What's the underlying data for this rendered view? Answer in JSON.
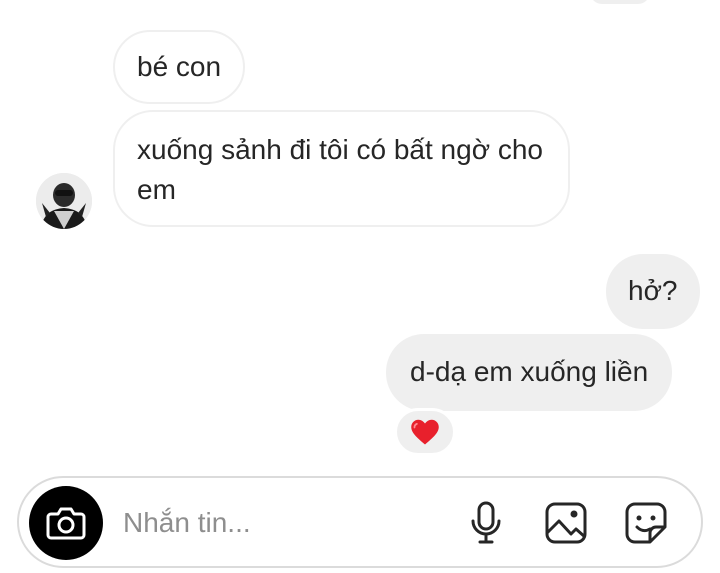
{
  "messages": [
    {
      "sender": "them",
      "text": "bé con"
    },
    {
      "sender": "them",
      "text": "xuống sảnh đi tôi có bất ngờ cho em"
    },
    {
      "sender": "me",
      "text": "hở?"
    },
    {
      "sender": "me",
      "text": "d-dạ em xuống liền",
      "reaction": "❤️"
    }
  ],
  "composer": {
    "placeholder": "Nhắn tin..."
  },
  "icons": {
    "camera": "camera-icon",
    "mic": "microphone-icon",
    "gallery": "gallery-icon",
    "sticker": "sticker-icon"
  },
  "colors": {
    "incoming_border": "#efefef",
    "outgoing_bg": "#efefef",
    "camera_button": "#000000"
  }
}
